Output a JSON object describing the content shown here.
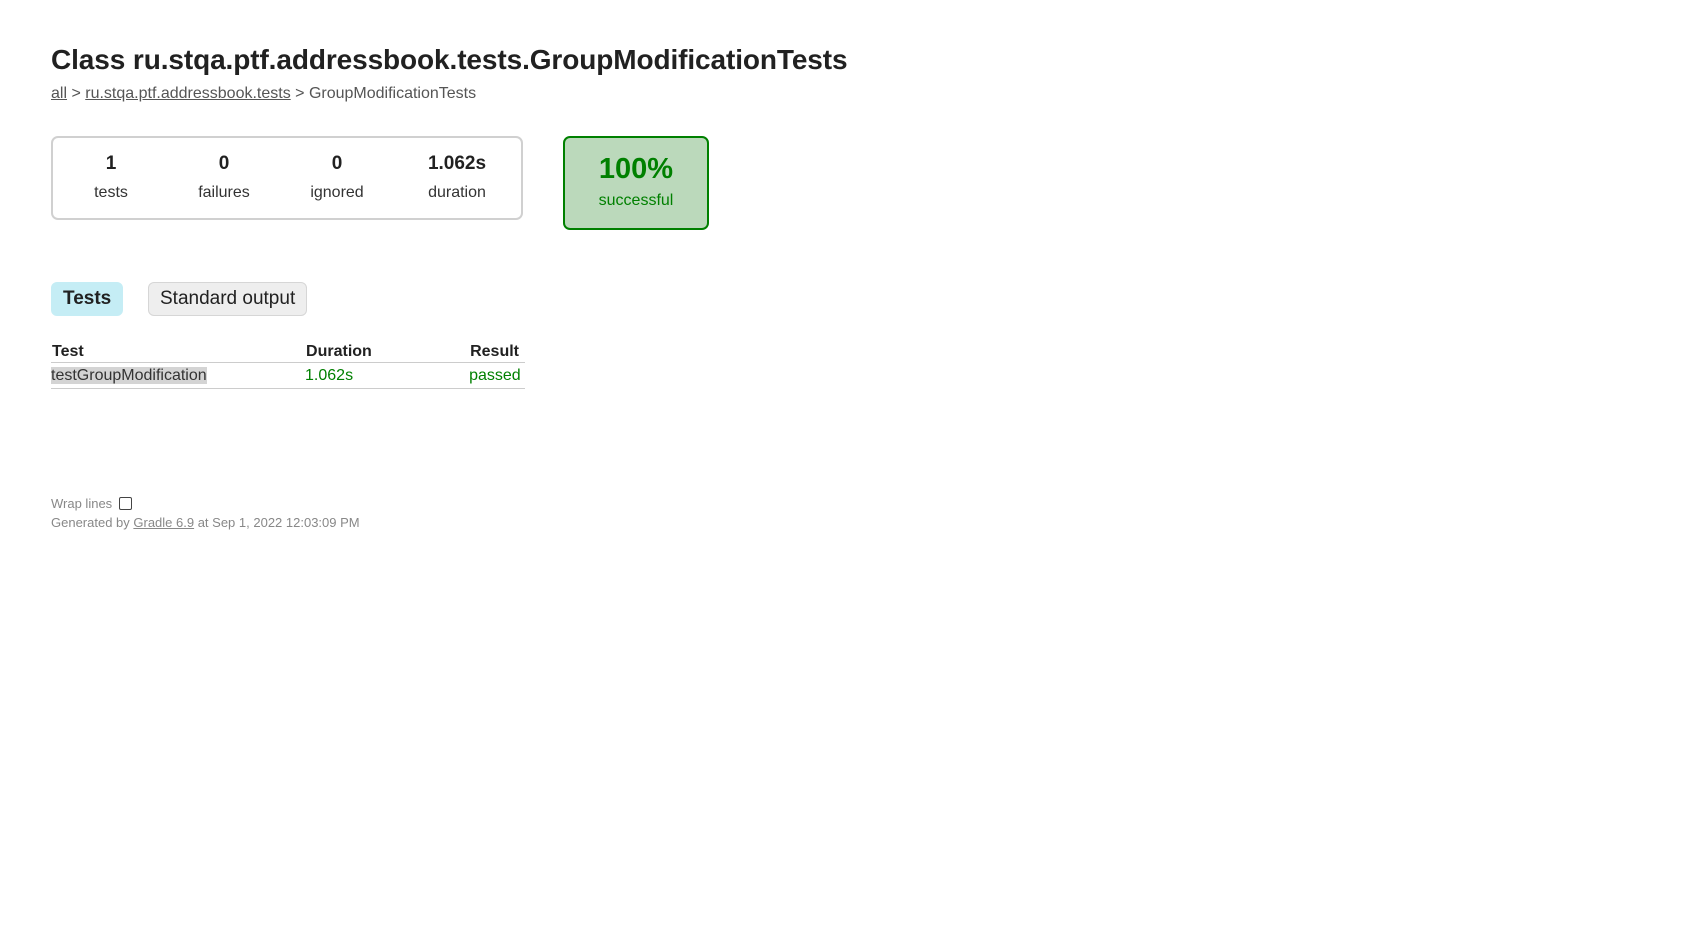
{
  "header": {
    "title": "Class ru.stqa.ptf.addressbook.tests.GroupModificationTests"
  },
  "breadcrumb": {
    "all": "all",
    "sep1": " > ",
    "package": "ru.stqa.ptf.addressbook.tests",
    "sep2": " > ",
    "current": "GroupModificationTests"
  },
  "summary": {
    "tests": {
      "value": "1",
      "label": "tests"
    },
    "failures": {
      "value": "0",
      "label": "failures"
    },
    "ignored": {
      "value": "0",
      "label": "ignored"
    },
    "duration": {
      "value": "1.062s",
      "label": "duration"
    }
  },
  "success_rate": {
    "value": "100%",
    "label": "successful"
  },
  "tabs": [
    {
      "label": "Tests",
      "active": true
    },
    {
      "label": "Standard output",
      "active": false
    }
  ],
  "table": {
    "headers": [
      "Test",
      "Duration",
      "Result"
    ],
    "rows": [
      {
        "test": "testGroupModification",
        "duration": "1.062s",
        "result": "passed"
      }
    ]
  },
  "footer": {
    "wrap_label": "Wrap lines",
    "generated_prefix": "Generated by ",
    "generator_link": "Gradle 6.9",
    "generated_suffix": " at Sep 1, 2022 12:03:09 PM"
  },
  "colors": {
    "success": "#008000",
    "success_bg": "#bbd9bb",
    "active_tab_bg": "#c5edf5"
  }
}
